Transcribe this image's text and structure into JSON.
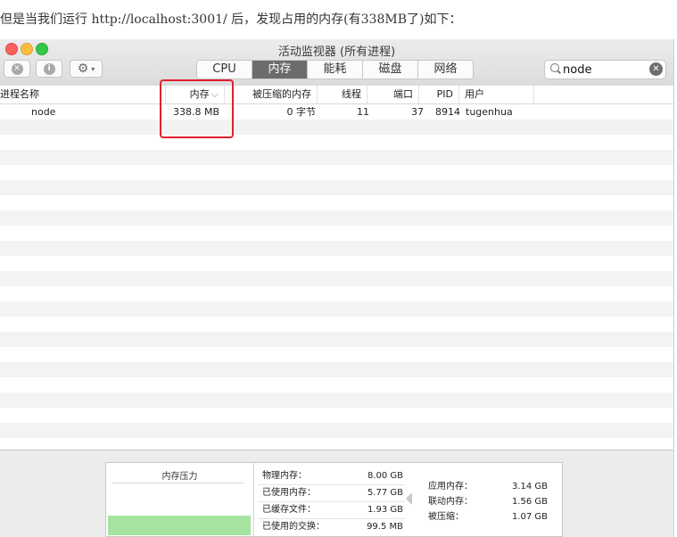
{
  "caption": "但是当我们运行 http://localhost:3001/ 后，发现占用的内存(有338MB了)如下：",
  "window": {
    "title": "活动监视器 (所有进程)",
    "tabs": [
      "CPU",
      "内存",
      "能耗",
      "磁盘",
      "网络"
    ],
    "active_tab": "内存",
    "search": {
      "value": "node"
    }
  },
  "table": {
    "columns": [
      "进程名称",
      "内存",
      "被压缩的内存",
      "线程",
      "端口",
      "PID",
      "用户"
    ],
    "sort_indicator": "⌵",
    "rows": [
      {
        "name": "node",
        "memory": "338.8 MB",
        "compressed": "0 字节",
        "threads": "11",
        "ports": "37",
        "pid": "8914",
        "user": "tugenhua"
      }
    ]
  },
  "memory_panel": {
    "pressure_title": "内存压力",
    "stats": [
      {
        "label": "物理内存：",
        "value": "8.00 GB"
      },
      {
        "label": "已使用内存：",
        "value": "5.77 GB"
      },
      {
        "label": "已缓存文件：",
        "value": "1.93 GB"
      },
      {
        "label": "已使用的交换：",
        "value": "99.5 MB"
      }
    ],
    "breakdown": [
      {
        "label": "应用内存：",
        "value": "3.14 GB"
      },
      {
        "label": "联动内存：",
        "value": "1.56 GB"
      },
      {
        "label": "被压缩：",
        "value": "1.07 GB"
      }
    ]
  },
  "colors": {
    "accent_highlight": "#e0222c",
    "active_tab": "#6c6c6c",
    "pressure_green": "#a6e3a1"
  }
}
